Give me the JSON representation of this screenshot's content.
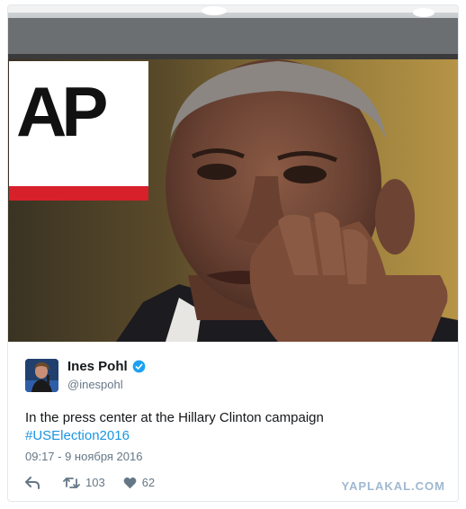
{
  "media": {
    "logo_text": "AP",
    "colors": {
      "logo_red": "#d8202b",
      "logo_bg": "#ffffff"
    }
  },
  "tweet": {
    "author_name": "Ines Pohl",
    "author_handle": "@inespohl",
    "verified": true,
    "text_main": "In the press center at the Hillary Clinton campaign",
    "hashtag": "#USElection2016",
    "timestamp": "09:17 - 9 ноября 2016",
    "actions": {
      "reply_icon": "reply-icon",
      "retweet_icon": "retweet-icon",
      "retweet_count": "103",
      "like_icon": "heart-icon",
      "like_count": "62"
    },
    "colors": {
      "link": "#1b95e0",
      "muted": "#657786",
      "text": "#14171a"
    }
  },
  "watermark": "YAPLAKAL.COM"
}
